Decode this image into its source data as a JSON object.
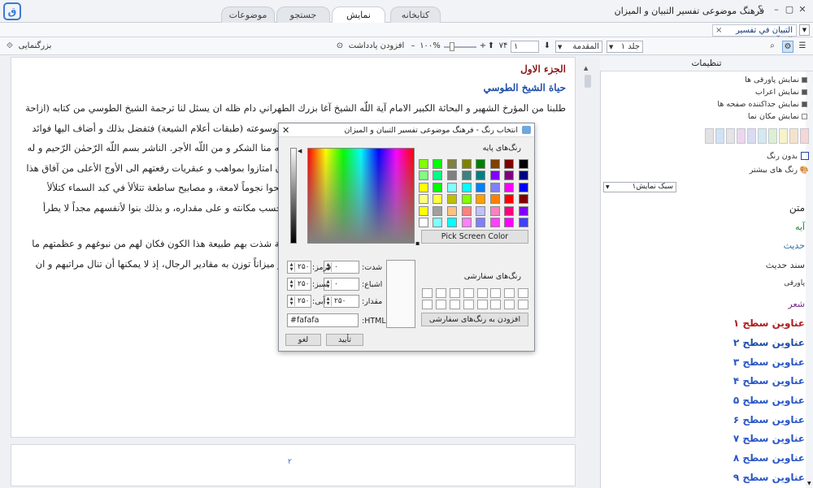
{
  "app": {
    "title": "فرهنگ موضوعی تفسیر التبیان و المیزان",
    "help": "؟"
  },
  "tabs": [
    {
      "label": "کتابخانه",
      "active": false
    },
    {
      "label": "نمایش",
      "active": true
    },
    {
      "label": "جستجو",
      "active": false
    },
    {
      "label": "موضوعات",
      "active": false
    }
  ],
  "doc_tab": {
    "label": "التبيان في تفسير القرآن"
  },
  "toolbar": {
    "zoom_label": "بزرگنمایی",
    "volume": "جلد ۱",
    "section": "المقدمة",
    "page": "۱",
    "page_count": "۷۴",
    "zoom": "۱۰۰%",
    "add_note": "افزودن یادداشت"
  },
  "document": {
    "heading1": "الجزء الاول",
    "heading2": "حياة الشيخ الطوسي",
    "lines": [
      "طلبنا من المؤرخ الشهير و البحاثة الكبير الامام آية اللّه الشيخ آغا بزرك الطهراني دام ظله ان يسئل لنا ترجمة الشيخ الطوسي من كتابه (ازاحة",
      "موسوعته (طبقات أعلام الشيعة) فتفضل بذلك و أضاف اليها فوائد",
      "له منا الشكر و من اللّه الأجر. الناشر بسم اللّه الرّحمٰن الرّحيم و له",
      "ن امتازوا بمواهب و عبقريات رفعتهم الى الأوج الأعلى من آفاق هذا",
      "بحوا نجوماً لامعة، و مصابيح ساطعة تتلألأ في كبد السماء كتلألأ",
      "حسب مكانته و على مقداره، و بذلك بنوا لأنفسهم مجداً لا يطرأ",
      "ية شذت بهم طبيعة هذا الكون فكان لهم من نبوغهم و عظمتهم ما",
      "و ميزاناً توزن به مقادير الرجال، إذ لا يمكنها أن تنال مراتبهم و ان"
    ],
    "page_number": "۲"
  },
  "panel": {
    "title": "تنظیمات",
    "checkboxes": [
      {
        "label": "نمایش پاورقی ها",
        "checked": true
      },
      {
        "label": "نمایش اعراب",
        "checked": true
      },
      {
        "label": "نمایش جداکننده صفحه ها",
        "checked": true
      },
      {
        "label": "نمایش مکان نما",
        "checked": false
      }
    ],
    "swatches": [
      "#f6d6d6",
      "#f6e2cc",
      "#f7f2c9",
      "#dcefd3",
      "#d3e9f2",
      "#d9dcf3",
      "#ecd6ee",
      "#e4e4e4",
      "#cfe3f5",
      "#e2e2e2"
    ],
    "no_color": "بدون رنگ",
    "more_colors": "رنگ های بیشتر",
    "style_select": "سبک نمایش۱",
    "styles": [
      {
        "label": "متن",
        "color": "#222222",
        "size": 12
      },
      {
        "label": "آیه",
        "color": "#1e8b3a",
        "size": 11
      },
      {
        "label": "حدیث",
        "color": "#2d6ea8",
        "size": 11
      },
      {
        "label": "سند حدیث",
        "color": "#333333",
        "size": 11
      },
      {
        "label": "پاورقی",
        "color": "#333333",
        "size": 9
      },
      {
        "label": "شعر",
        "color": "#7a2a8a",
        "size": 11
      },
      {
        "label": "عناوین سطح ۱",
        "color": "#b01e1e",
        "size": 12
      },
      {
        "label": "عناوین سطح ۲",
        "color": "#1f4fa8",
        "size": 12
      },
      {
        "label": "عناوین سطح ۳",
        "color": "#2a57c6",
        "size": 12
      },
      {
        "label": "عناوین سطح ۴",
        "color": "#2a57c6",
        "size": 12
      },
      {
        "label": "عناوین سطح ۵",
        "color": "#2a57c6",
        "size": 12
      },
      {
        "label": "عناوین سطح ۶",
        "color": "#2a57c6",
        "size": 12
      },
      {
        "label": "عناوین سطح ۷",
        "color": "#2a57c6",
        "size": 12
      },
      {
        "label": "عناوین سطح ۸",
        "color": "#2a57c6",
        "size": 12
      },
      {
        "label": "عناوین سطح ۹",
        "color": "#2a57c6",
        "size": 12
      }
    ]
  },
  "dialog": {
    "title": "انتخاب رنگ - فرهنگ موضوعی تفسیر التبیان و المیزان",
    "basic_colors": "رنگ‌های پایه",
    "pick_screen": "Pick Screen Color",
    "custom_colors": "رنگ‌های سفارشی",
    "add_custom": "افزودن به رنگ‌های سفارشی",
    "hue_label": "شدت:",
    "sat_label": "اشباع:",
    "val_label": "مقدار:",
    "red_label": "قرمز:",
    "green_label": "سبز:",
    "blue_label": "آبی:",
    "hue": "۰",
    "sat": "۰",
    "val": "۲۵۰",
    "red": "۲۵۰",
    "green": "۲۵۰",
    "blue": "۲۵۰",
    "html_label": "HTML:",
    "html_value": "#fafafa",
    "ok": "تأیید",
    "cancel": "لغو",
    "palette": [
      "#000000",
      "#800000",
      "#804000",
      "#008000",
      "#808000",
      "#808040",
      "#00ff00",
      "#80ff00",
      "#000080",
      "#800080",
      "#8000ff",
      "#008080",
      "#408080",
      "#808080",
      "#00ff80",
      "#80ff80",
      "#0000ff",
      "#ff00ff",
      "#8080ff",
      "#0080ff",
      "#00ffff",
      "#80ffff",
      "#00ff00",
      "#ffff00",
      "#800000",
      "#ff0000",
      "#ff8000",
      "#ffa000",
      "#80ff00",
      "#c0c000",
      "#ffff40",
      "#ffff80",
      "#8000ff",
      "#ff0080",
      "#ff80c0",
      "#c0c0ff",
      "#ff8080",
      "#ffc080",
      "#a0a0a0",
      "#ffff00",
      "#4040ff",
      "#ff00ff",
      "#ff40ff",
      "#8080ff",
      "#ff80ff",
      "#00ffff",
      "#80ffff",
      "#ffffff"
    ]
  }
}
